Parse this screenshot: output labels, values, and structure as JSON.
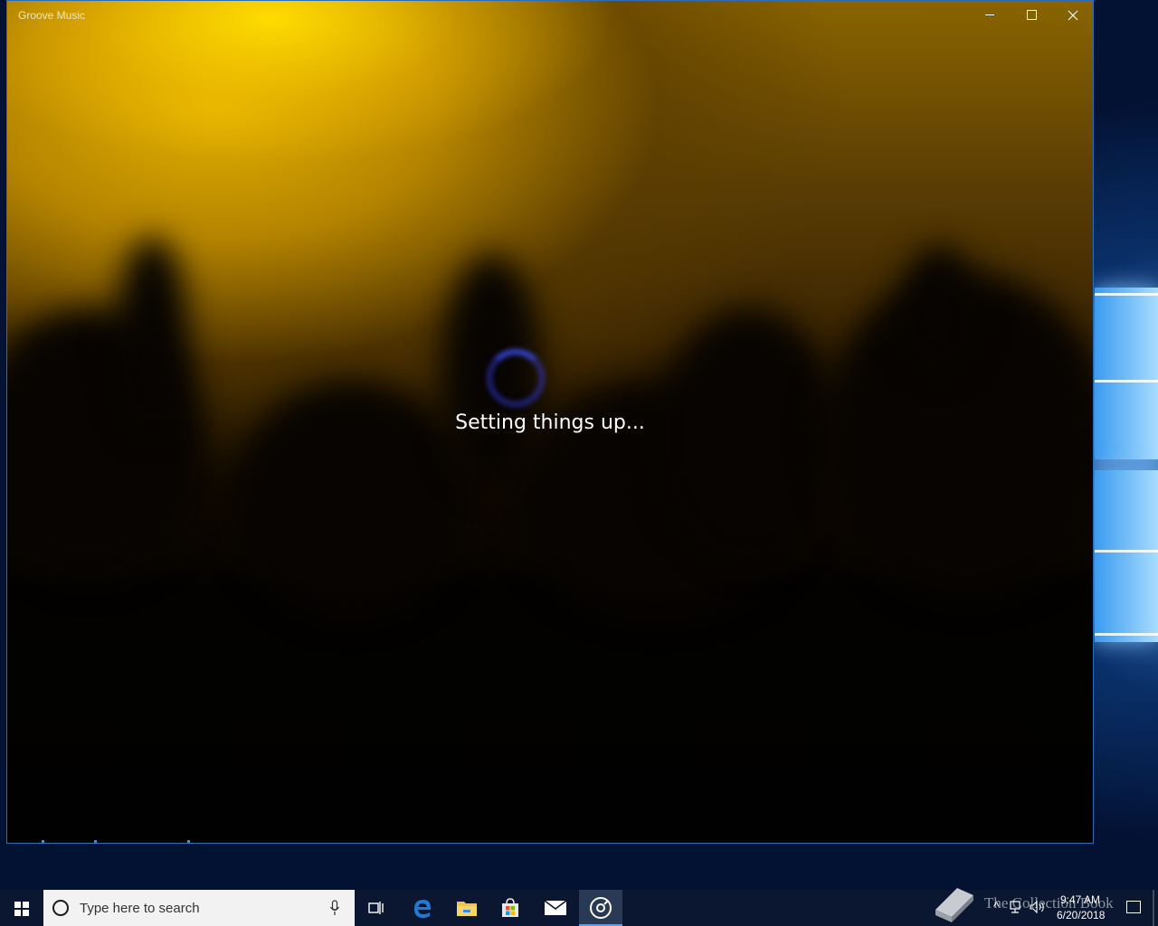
{
  "window": {
    "title": "Groove Music",
    "status_text": "Setting things up..."
  },
  "taskbar": {
    "search_placeholder": "Type here to search",
    "watermark": "The Collection Book",
    "clock_time": "9:47 AM",
    "clock_date": "6/20/2018",
    "pinned": [
      "task-view",
      "microsoft-edge",
      "file-explorer",
      "microsoft-store",
      "mail",
      "groove-music"
    ]
  },
  "colors": {
    "accent": "#2f6cb8",
    "taskbar": "#0b1730",
    "active_underline": "#5aa0e8"
  }
}
